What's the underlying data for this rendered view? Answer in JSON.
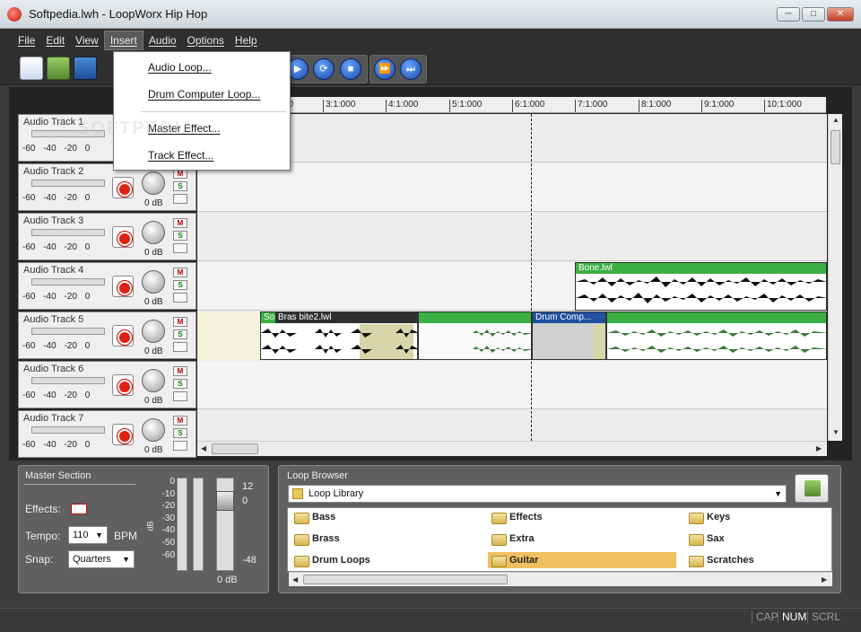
{
  "window": {
    "title": "Softpedia.lwh - LoopWorx Hip Hop",
    "min": "─",
    "max": "□",
    "close": "✕"
  },
  "menu": [
    "File",
    "Edit",
    "View",
    "Insert",
    "Audio",
    "Options",
    "Help"
  ],
  "insert_menu": {
    "items": [
      "Audio Loop...",
      "Drum Computer Loop...",
      "Master Effect...",
      "Track Effect..."
    ]
  },
  "watermark": "SOFTPEDIA",
  "ruler": [
    "3:1:000",
    "4:1:000",
    "5:1:000",
    "6:1:000",
    "7:1:000",
    "8:1:000",
    "9:1:000",
    "10:1:000"
  ],
  "ruler_partial": "00",
  "tracks": [
    {
      "name": "Audio Track 1"
    },
    {
      "name": "Audio Track 2"
    },
    {
      "name": "Audio Track 3"
    },
    {
      "name": "Audio Track 4"
    },
    {
      "name": "Audio Track 5"
    },
    {
      "name": "Audio Track 6"
    },
    {
      "name": "Audio Track 7"
    }
  ],
  "track_scale": "-60 -40 -20 0",
  "track_db": "0 dB",
  "track_btns": {
    "mute": "M",
    "solo": "S"
  },
  "clips": {
    "bone": "Bone.lwl",
    "so": "So",
    "bras": "Bras bite2.lwl",
    "drum": "Drum Comp..."
  },
  "toolbar_icons": [
    "new-document-icon",
    "open-folder-icon",
    "save-icon"
  ],
  "transport": [
    "▶",
    "⟳",
    "■",
    "⏩",
    "⏭"
  ],
  "master": {
    "title": "Master Section",
    "effects": "Effects:",
    "tempo": "Tempo:",
    "tempo_value": "110",
    "bpm": "BPM",
    "snap": "Snap:",
    "snap_value": "Quarters",
    "db_label": "dB",
    "out_db": "0 dB",
    "vu_scale": [
      "0",
      "-10",
      "-20",
      "-30",
      "-40",
      "-50",
      "-60"
    ],
    "fader_scale": [
      "12",
      "0",
      "-48"
    ]
  },
  "browser": {
    "title": "Loop Browser",
    "library": "Loop Library",
    "folders": [
      "Bass",
      "Effects",
      "Keys",
      "Brass",
      "Extra",
      "Sax",
      "Drum Loops",
      "Guitar",
      "Scratches"
    ],
    "selected": "Guitar"
  },
  "status": [
    "CAP",
    "NUM",
    "SCRL"
  ],
  "colors": {
    "green": "#3cb043",
    "blue_clip": "#2050a0",
    "accent": "#e02010"
  }
}
